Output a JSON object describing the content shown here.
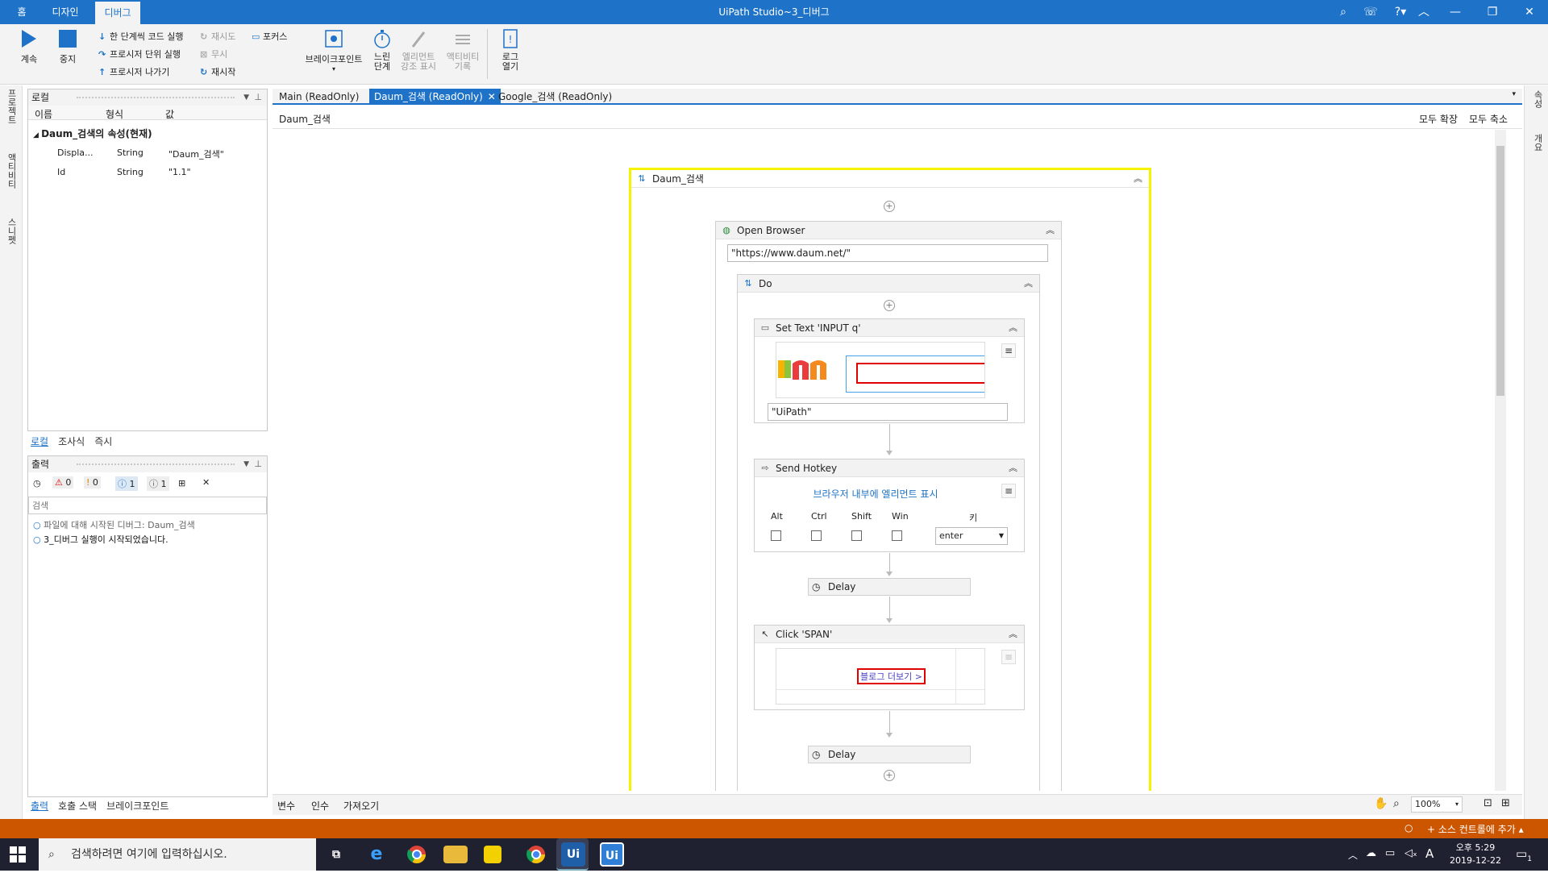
{
  "window": {
    "title": "UiPath Studio~3_디버그"
  },
  "top_tabs": [
    "홈",
    "디자인",
    "디버그"
  ],
  "ribbon": {
    "continue": "계속",
    "stop": "중지",
    "step_into": "한 단계씩 코드 실행",
    "step_over": "프로시저 단위 실행",
    "step_out": "프로시저 나가기",
    "retry": "재시도",
    "ignore": "무시",
    "restart": "재시작",
    "focus": "포커스",
    "breakpoints": "브레이크포인트",
    "slow_step": [
      "느린",
      "단계"
    ],
    "highlight": [
      "엘리먼트",
      "강조 표시"
    ],
    "log_activities": [
      "액티비티",
      "기록"
    ],
    "open_logs": [
      "로그",
      "열기"
    ]
  },
  "left_strip": [
    "프로젝트",
    "액티비티",
    "스니펫"
  ],
  "locals_panel": {
    "title": "로컬",
    "columns": [
      "이름",
      "형식",
      "값"
    ],
    "group": "Daum_검색의 속성(현재)",
    "rows": [
      {
        "name": "Displa...",
        "type": "String",
        "value": "\"Daum_검색\""
      },
      {
        "name": "Id",
        "type": "String",
        "value": "\"1.1\""
      }
    ],
    "tabs": [
      "로컬",
      "조사식",
      "즉시"
    ]
  },
  "output_panel": {
    "title": "출력",
    "counts": {
      "errors": "0",
      "warnings": "0",
      "info": "1",
      "trace": "1"
    },
    "search_placeholder": "검색",
    "messages": [
      "파일에 대해 시작된 디버그: Daum_검색",
      "3_디버그 실행이 시작되었습니다."
    ],
    "tabs": [
      "출력",
      "호출 스택",
      "브레이크포인트"
    ]
  },
  "doc_tabs": [
    "Main (ReadOnly)",
    "Daum_검색 (ReadOnly)",
    "Google_검색 (ReadOnly)"
  ],
  "breadcrumb": "Daum_검색",
  "expand_all": "모두 확장",
  "collapse_all": "모두 축소",
  "workflow": {
    "sequence": "Daum_검색",
    "open_browser": {
      "title": "Open Browser",
      "url": "\"https://www.daum.net/\""
    },
    "do": "Do",
    "set_text": {
      "title": "Set Text 'INPUT  q'",
      "text": "\"UiPath\""
    },
    "send_hotkey": {
      "title": "Send Hotkey",
      "link": "브라우저 내부에 엘리먼트 표시",
      "modifiers": [
        "Alt",
        "Ctrl",
        "Shift",
        "Win"
      ],
      "key_label": "키",
      "key": "enter"
    },
    "delay1": "Delay",
    "click": {
      "title": "Click 'SPAN'",
      "preview_text": "블로그 더보기 >"
    },
    "delay2": "Delay"
  },
  "right_strip": [
    "속성",
    "개요"
  ],
  "bottom_tabs": [
    "변수",
    "인수",
    "가져오기"
  ],
  "zoom": "100%",
  "status": {
    "source_control": "소스 컨트롤에 추가"
  },
  "taskbar": {
    "search_placeholder": "검색하려면 여기에 입력하십시오.",
    "time": "오후 5:29",
    "date": "2019-12-22",
    "notifications": "1",
    "ime": "A"
  },
  "colors": {
    "accent": "#1e73c8",
    "status": "#cc5500",
    "breakpoint_highlight": "#f4f400",
    "selector_red": "#e00000"
  }
}
